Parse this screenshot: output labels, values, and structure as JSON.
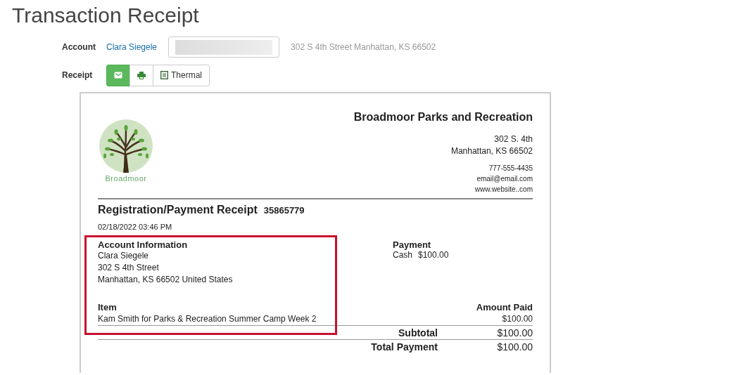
{
  "page_title": "Transaction Receipt",
  "account": {
    "label": "Account",
    "name": "Clara Siegele",
    "address": "302 S 4th Street Manhattan, KS 66502"
  },
  "receipt_options": {
    "label": "Receipt",
    "buttons": [
      {
        "kind": "email",
        "selected": true
      },
      {
        "kind": "print",
        "selected": false
      },
      {
        "kind": "thermal",
        "label": "Thermal",
        "selected": false
      }
    ]
  },
  "receipt": {
    "org_name": "Broadmoor Parks and Recreation",
    "logo_text": "Broadmoor",
    "address_lines": [
      "302 S. 4th",
      "Manhattan, KS 66502"
    ],
    "contact_lines": [
      "777-555-4435",
      "email@email.com",
      "www.website..com"
    ],
    "title": "Registration/Payment Receipt",
    "number": "35865779",
    "date": "02/18/2022 03:46 PM",
    "account_info": {
      "heading": "Account Information",
      "lines": [
        "Clara Siegele",
        "302 S 4th Street",
        "Manhattan, KS 66502 United States"
      ]
    },
    "payment": {
      "heading": "Payment",
      "method": "Cash",
      "amount": "$100.00"
    },
    "items": {
      "columns": [
        "Item",
        "Amount Paid"
      ],
      "rows": [
        {
          "item": "Kam Smith for Parks & Recreation Summer Camp Week 2",
          "amount": "$100.00"
        }
      ]
    },
    "totals": [
      {
        "label": "Subtotal",
        "value": "$100.00"
      },
      {
        "label": "Total Payment",
        "value": "$100.00"
      }
    ],
    "highlight": true
  }
}
